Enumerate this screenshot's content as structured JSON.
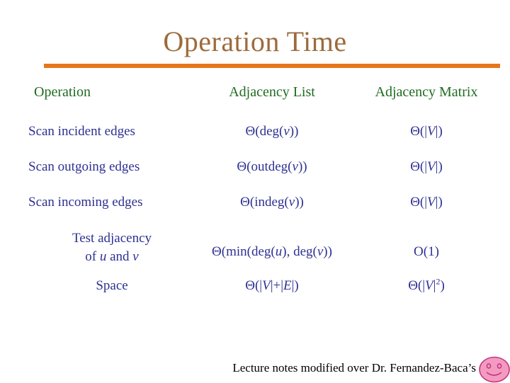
{
  "slide": {
    "title": "Operation Time",
    "title_color": "#9C6B3C",
    "rule_color": "#E8751A",
    "background_color": "#FFFFFF",
    "header_text_color": "#1F6B1F",
    "body_text_color": "#2E3192"
  },
  "table": {
    "columns": [
      {
        "label": "Operation"
      },
      {
        "label": "Adjacency List"
      },
      {
        "label": "Adjacency Matrix"
      }
    ],
    "rows": [
      {
        "operation": "Scan incident edges",
        "adjacency_list": "Θ(deg(v))",
        "adjacency_matrix": "Θ(|V|)"
      },
      {
        "operation": "Scan outgoing edges",
        "adjacency_list": "Θ(outdeg(v))",
        "adjacency_matrix": "Θ(|V|)"
      },
      {
        "operation": "Scan incoming edges",
        "adjacency_list": "Θ(indeg(v))",
        "adjacency_matrix": "Θ(|V|)"
      },
      {
        "operation_line1": "Test adjacency",
        "operation_line2": "of u  and v",
        "adjacency_list": "Θ(min(deg(u), deg(v))",
        "adjacency_matrix": "O(1)"
      },
      {
        "operation": "Space",
        "adjacency_list": "Θ(|V|+|E|)",
        "adjacency_matrix_base": "Θ(|V|",
        "adjacency_matrix_sup": "2",
        "adjacency_matrix_tail": ")"
      }
    ]
  },
  "footer": {
    "text": "Lecture notes modified over Dr. Fernandez-Baca’s",
    "smiley_icon": "smiley-face-icon",
    "smiley_fill": "#F49AC1",
    "smiley_stroke": "#C0377E"
  }
}
